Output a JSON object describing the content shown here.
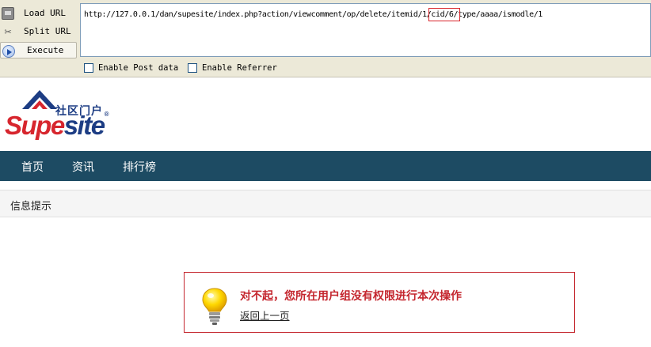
{
  "hackbar": {
    "load_url_label": "Load URL",
    "split_url_label": "Split URL",
    "execute_label": "Execute",
    "url_prefix": "http://127.0.0.1/dan/supesite/index.php?action/viewcomment/op/delete/itemid/1/",
    "url_highlight": "cid/6/",
    "url_suffix": "type/aaaa/ismodle/1",
    "highlight_color": "#d9252b",
    "enable_post_label": "Enable Post data",
    "enable_referrer_label": "Enable Referrer",
    "enable_post_checked": false,
    "enable_referrer_checked": false
  },
  "site": {
    "logo_cn": "社区门户",
    "logo_en_part1": "Supe",
    "logo_en_part2": "site",
    "logo_reg": "®",
    "brand_red": "#d7262e",
    "brand_blue": "#1d3d84"
  },
  "nav": {
    "background": "#1d4b63",
    "items": [
      {
        "label": "首页"
      },
      {
        "label": "资讯"
      },
      {
        "label": "排行榜"
      }
    ]
  },
  "info": {
    "title": "信息提示"
  },
  "message": {
    "icon": "lightbulb-icon",
    "text": "对不起，您所在用户组没有权限进行本次操作",
    "back_link": "返回上一页",
    "accent": "#c4262e"
  }
}
